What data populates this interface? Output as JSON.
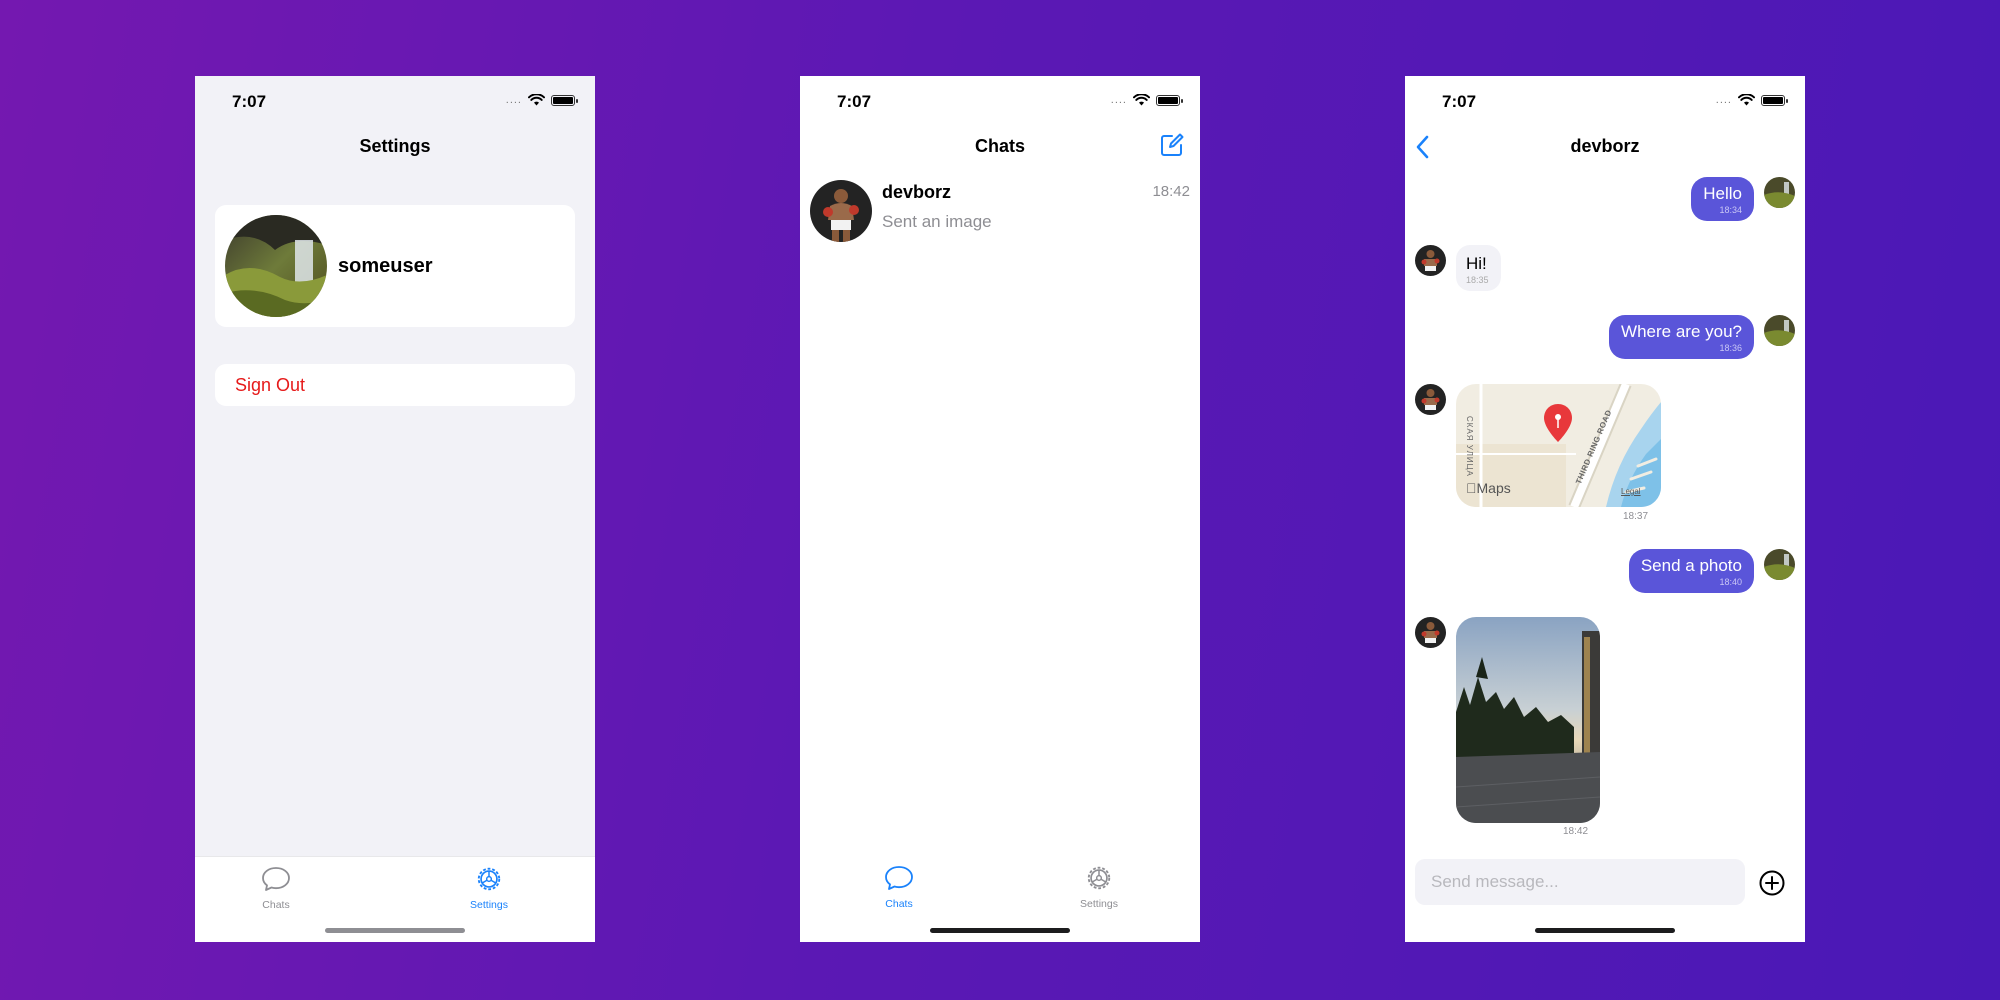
{
  "colors": {
    "accent": "#1a82fb",
    "outgoing_bubble": "#5a55d9",
    "destructive": "#e61a1a",
    "grouped_background": "#f2f2f7"
  },
  "settings_screen": {
    "status_time": "7:07",
    "title": "Settings",
    "profile": {
      "username": "someuser",
      "avatar": "waterfall-landscape-avatar"
    },
    "sign_out_label": "Sign Out",
    "tabs": [
      {
        "label": "Chats",
        "icon": "chat-bubble-icon",
        "active": false
      },
      {
        "label": "Settings",
        "icon": "gear-icon",
        "active": true
      }
    ]
  },
  "chats_screen": {
    "status_time": "7:07",
    "title": "Chats",
    "compose_icon": "compose-icon",
    "conversations": [
      {
        "name": "devborz",
        "preview": "Sent an image",
        "time": "18:42",
        "avatar": "boxer-avatar"
      }
    ],
    "tabs": [
      {
        "label": "Chats",
        "icon": "chat-bubble-icon",
        "active": true
      },
      {
        "label": "Settings",
        "icon": "gear-icon",
        "active": false
      }
    ]
  },
  "conversation_screen": {
    "status_time": "7:07",
    "title": "devborz",
    "back_icon": "chevron-left-icon",
    "messages": [
      {
        "direction": "outgoing",
        "kind": "text",
        "text": "Hello",
        "time": "18:34"
      },
      {
        "direction": "incoming",
        "kind": "text",
        "text": "Hi!",
        "time": "18:35"
      },
      {
        "direction": "outgoing",
        "kind": "text",
        "text": "Where are you?",
        "time": "18:36"
      },
      {
        "direction": "incoming",
        "kind": "location",
        "time": "18:37",
        "map_brand": "Maps",
        "map_legal": "Legal",
        "map_streets": [
          "THIRD RING ROAD",
          "СКАЯ УЛИЦА"
        ]
      },
      {
        "direction": "outgoing",
        "kind": "text",
        "text": "Send a photo",
        "time": "18:40"
      },
      {
        "direction": "incoming",
        "kind": "image",
        "time": "18:42"
      }
    ],
    "composer": {
      "placeholder": "Send message...",
      "add_icon": "plus-circle-icon"
    }
  }
}
